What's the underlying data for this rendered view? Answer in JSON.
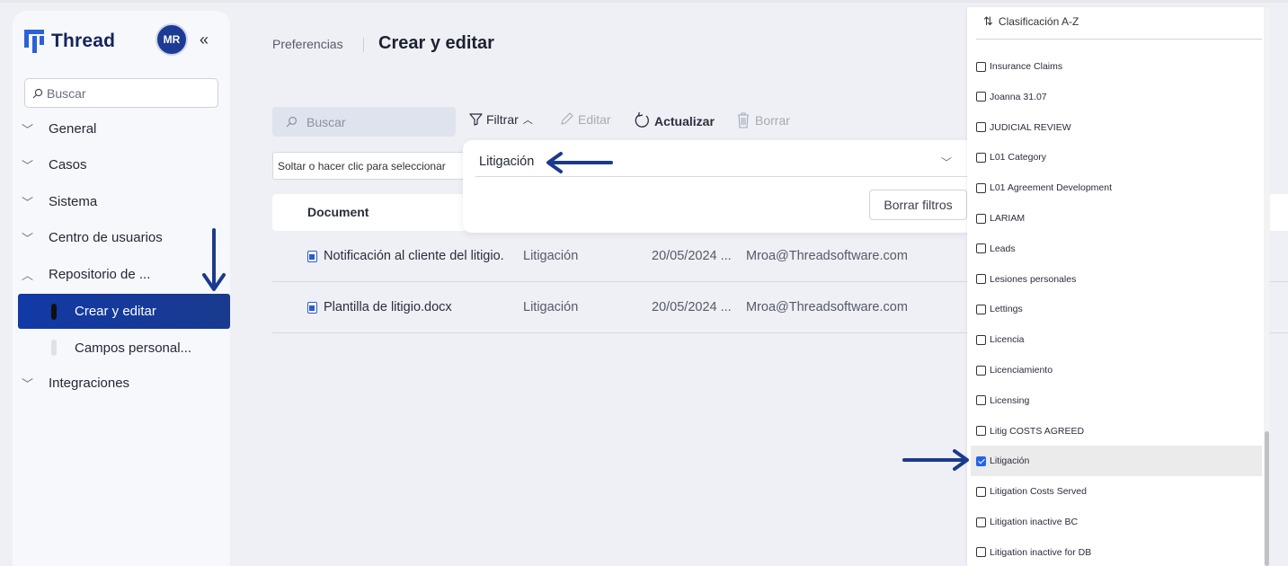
{
  "brand": {
    "name": "Thread",
    "avatar_initials": "MR"
  },
  "sidebar": {
    "search_placeholder": "Buscar",
    "items": [
      {
        "label": "General"
      },
      {
        "label": "Casos"
      },
      {
        "label": "Sistema"
      },
      {
        "label": "Centro de usuarios"
      },
      {
        "label": "Repositorio de ..."
      },
      {
        "label": "Integraciones"
      }
    ],
    "sub_items": [
      {
        "label": "Crear y editar",
        "active": true
      },
      {
        "label": "Campos personal..."
      }
    ]
  },
  "header": {
    "breadcrumb": "Preferencias",
    "title": "Crear y editar"
  },
  "toolbar": {
    "search_placeholder": "Buscar",
    "filter_label": "Filtrar",
    "edit_label": "Editar",
    "refresh_label": "Actualizar",
    "delete_label": "Borrar"
  },
  "group_bar": "Soltar o hacer clic para seleccionar",
  "table": {
    "column_header": "Document",
    "rows": [
      {
        "name": "Notificación al cliente del litigio.",
        "category": "Litigación",
        "date": "20/05/2024 ...",
        "user": "Mroa@Threadsoftware.com"
      },
      {
        "name": "Plantilla de litigio.docx",
        "category": "Litigación",
        "date": "20/05/2024 ...",
        "user": "Mroa@Threadsoftware.com"
      }
    ]
  },
  "filter_popup": {
    "selected_value": "Litigación",
    "clear_label": "Borrar filtros"
  },
  "dropdown": {
    "sort_label": "Clasificación A-Z",
    "options": [
      {
        "label": "Insurance Claims",
        "checked": false
      },
      {
        "label": "Joanna 31.07",
        "checked": false
      },
      {
        "label": "JUDICIAL REVIEW",
        "checked": false
      },
      {
        "label": "L01 Category",
        "checked": false
      },
      {
        "label": "L01 Agreement Development",
        "checked": false
      },
      {
        "label": "LARIAM",
        "checked": false
      },
      {
        "label": "Leads",
        "checked": false
      },
      {
        "label": "Lesiones personales",
        "checked": false
      },
      {
        "label": "Lettings",
        "checked": false
      },
      {
        "label": "Licencia",
        "checked": false
      },
      {
        "label": "Licenciamiento",
        "checked": false
      },
      {
        "label": "Licensing",
        "checked": false
      },
      {
        "label": "Litig COSTS AGREED",
        "checked": false
      },
      {
        "label": "Litigación",
        "checked": true
      },
      {
        "label": "Litigation Costs Served",
        "checked": false
      },
      {
        "label": "Litigation inactive BC",
        "checked": false
      },
      {
        "label": "Litigation inactive for DB",
        "checked": false
      }
    ]
  },
  "colors": {
    "primary": "#1a3a8f",
    "accent": "#2a62d8",
    "annotation_arrow": "#1b3a8c",
    "background": "#eef0f6"
  }
}
